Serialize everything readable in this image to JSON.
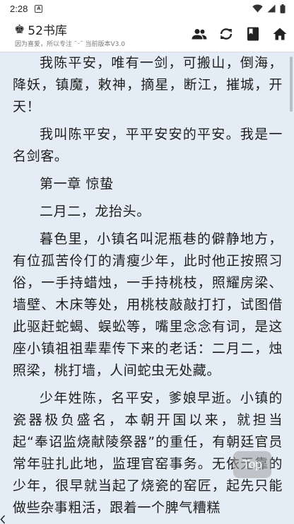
{
  "status_bar": {
    "time": "2:28"
  },
  "app_bar": {
    "title": "52书库",
    "subtitle": "因为喜爱，所以专注  ˘ᵕ˘  当前版本V3.0"
  },
  "content": {
    "paragraphs": [
      "我陈平安，唯有一剑，可搬山，倒海，降妖，镇魔，敕神，摘星，断江，摧城，开天！",
      "我叫陈平安，平平安安的平安。我是一名剑客。",
      "第一章 惊蛰",
      "二月二，龙抬头。",
      "暮色里，小镇名叫泥瓶巷的僻静地方，有位孤苦伶仃的清瘦少年，此时他正按照习俗，一手持蜡烛，一手持桃枝，照耀房梁、墙壁、木床等处，用桃枝敲敲打打，试图借此驱赶蛇蝎、蜈蚣等，嘴里念念有词，是这座小镇祖祖辈辈传下来的老话：二月二，烛照梁，桃打墙，人间蛇虫无处藏。",
      "少年姓陈，名平安，爹娘早逝。小镇的瓷器极负盛名，本朝开国以来，就担当起“奉诏监烧献陵祭器”的重任，有朝廷官员常年驻扎此地，监理官窑事务。无依无靠的少年，很早就当起了烧瓷的窑匠，起先只能做些杂事粗活，跟着一个脾气糟糕"
    ]
  },
  "top_button": {
    "label": "Top"
  },
  "icons": {
    "status": [
      "a-icon",
      "wifi-icon",
      "signal-icon",
      "battery-icon"
    ],
    "actions": [
      "people-icon",
      "refresh-icon",
      "book-icon",
      "home-icon"
    ]
  }
}
